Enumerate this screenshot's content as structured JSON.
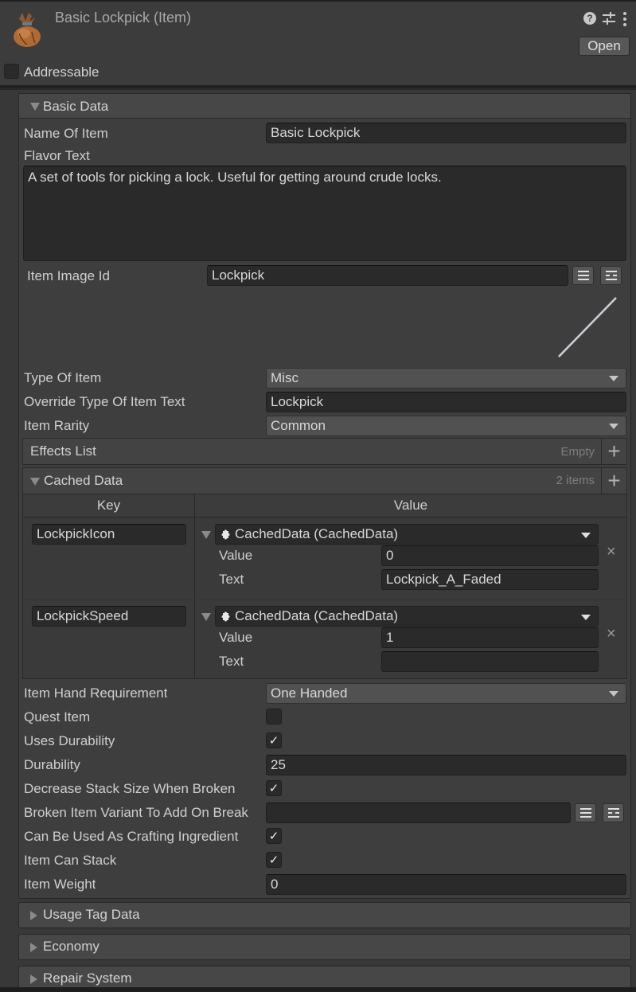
{
  "header": {
    "title": "Basic Lockpick (Item)",
    "icon": "item-bag-icon",
    "help_icon": "help-icon",
    "settings_icon": "preset-settings-icon",
    "more_icon": "more-vertical-icon",
    "open_label": "Open",
    "addressable_label": "Addressable",
    "addressable_checked": false
  },
  "basic_data": {
    "section_title": "Basic Data",
    "expanded": true,
    "name_of_item": {
      "label": "Name Of Item",
      "value": "Basic Lockpick"
    },
    "flavor_text": {
      "label": "Flavor Text",
      "value": "A set of tools for picking a lock. Useful for getting around crude locks."
    },
    "item_image_id": {
      "label": "Item Image Id",
      "value": "Lockpick",
      "preview": "lockpick-image"
    },
    "type_of_item": {
      "label": "Type Of Item",
      "value": "Misc"
    },
    "override_type_text": {
      "label": "Override Type Of Item Text",
      "value": "Lockpick"
    },
    "item_rarity": {
      "label": "Item Rarity",
      "value": "Common"
    },
    "effects_list": {
      "label": "Effects List",
      "count": "Empty"
    },
    "cached_data": {
      "label": "Cached Data",
      "count": "2 items",
      "columns": [
        "Key",
        "Value"
      ],
      "rows": [
        {
          "key": "LockpickIcon",
          "type": "CachedData (CachedData)",
          "value_label": "Value",
          "value": "0",
          "text_label": "Text",
          "text": "Lockpick_A_Faded"
        },
        {
          "key": "LockpickSpeed",
          "type": "CachedData (CachedData)",
          "value_label": "Value",
          "value": "1",
          "text_label": "Text",
          "text": ""
        }
      ]
    },
    "item_hand_requirement": {
      "label": "Item Hand Requirement",
      "value": "One Handed"
    },
    "quest_item": {
      "label": "Quest Item",
      "checked": false
    },
    "uses_durability": {
      "label": "Uses Durability",
      "checked": true
    },
    "durability": {
      "label": "Durability",
      "value": "25"
    },
    "decrease_stack": {
      "label": "Decrease Stack Size When Broken",
      "checked": true
    },
    "broken_variant": {
      "label": "Broken Item Variant To Add On Break",
      "value": ""
    },
    "crafting_ingredient": {
      "label": "Can Be Used As Crafting Ingredient",
      "checked": true
    },
    "item_can_stack": {
      "label": "Item Can Stack",
      "checked": true
    },
    "item_weight": {
      "label": "Item Weight",
      "value": "0"
    }
  },
  "collapsed_sections": [
    {
      "label": "Usage Tag Data"
    },
    {
      "label": "Economy"
    },
    {
      "label": "Repair System"
    }
  ],
  "check_glyph": "✓",
  "plus_glyph": "+",
  "x_glyph": "×"
}
